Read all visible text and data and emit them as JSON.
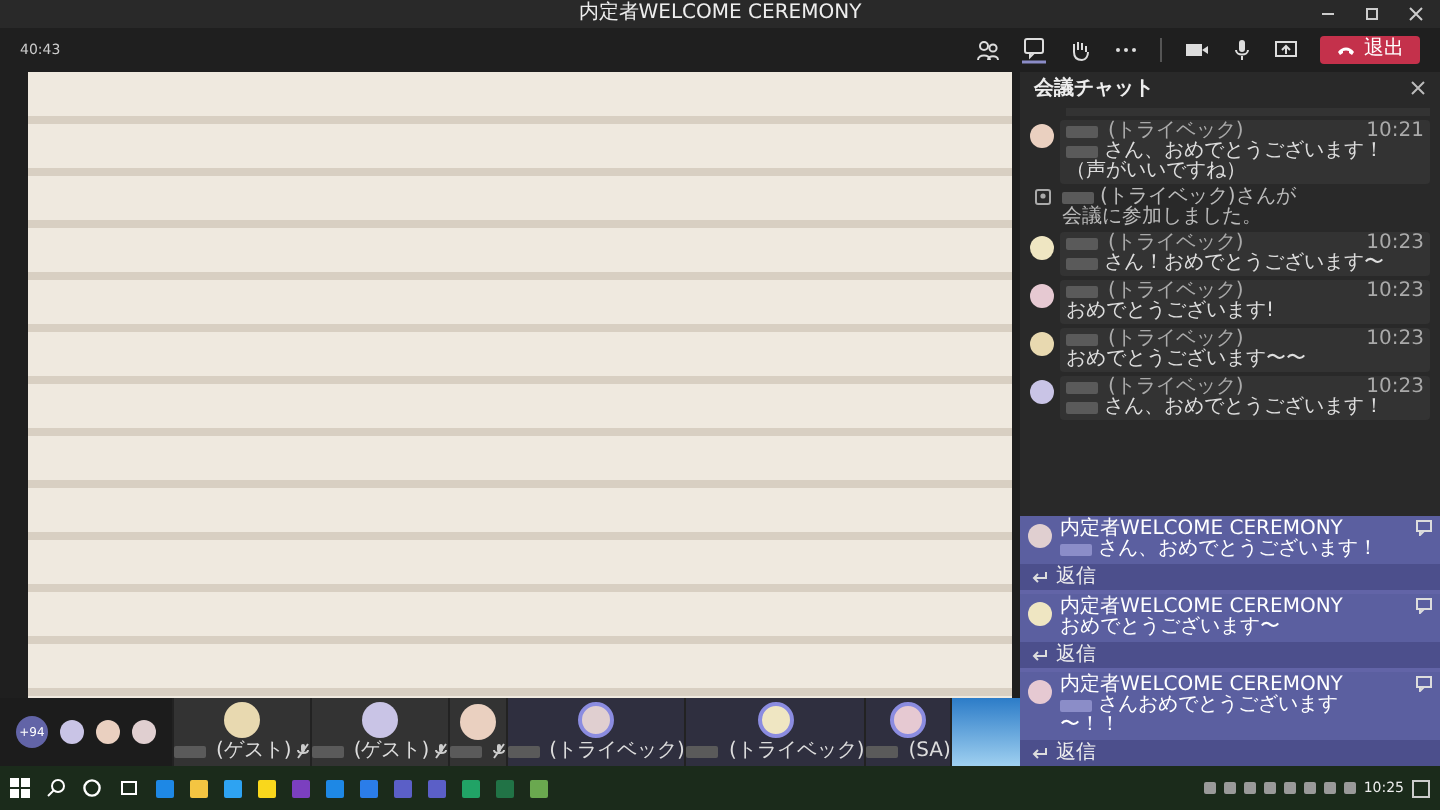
{
  "window": {
    "title": "内定者WELCOME CEREMONY"
  },
  "meeting_bar": {
    "timer": "40:43",
    "leave_label": "退出"
  },
  "chat": {
    "title": "会議チャット",
    "messages": [
      {
        "kind": "message",
        "org": "(トライベック)",
        "time": "10:21",
        "lines": [
          {
            "mention": true,
            "text": "さん、おめでとうございます！"
          },
          {
            "mention": false,
            "text": "（声がいいですね）"
          }
        ]
      },
      {
        "kind": "system",
        "org": "(トライベック)",
        "lines": [
          "さんが",
          "会議に参加しました。"
        ]
      },
      {
        "kind": "message",
        "org": "(トライベック)",
        "time": "10:23",
        "lines": [
          {
            "mention": true,
            "text": "さん！おめでとうございます〜"
          }
        ]
      },
      {
        "kind": "message",
        "org": "(トライベック)",
        "time": "10:23",
        "lines": [
          {
            "mention": false,
            "text": "おめでとうございます!"
          }
        ]
      },
      {
        "kind": "message",
        "org": "(トライベック)",
        "time": "10:23",
        "lines": [
          {
            "mention": false,
            "text": "おめでとうございます〜〜"
          }
        ]
      },
      {
        "kind": "message",
        "org": "(トライベック)",
        "time": "10:23",
        "lines": [
          {
            "mention": true,
            "text": "さん、おめでとうございます！"
          }
        ]
      }
    ],
    "notifications": [
      {
        "sender": "内定者WELCOME CEREMONY",
        "lines": [
          {
            "mention": true,
            "text": "さん、おめでとうございます！"
          }
        ],
        "reply_label": "返信"
      },
      {
        "sender": "内定者WELCOME CEREMONY",
        "lines": [
          {
            "mention": false,
            "text": "おめでとうございます〜"
          }
        ],
        "reply_label": "返信"
      },
      {
        "sender": "内定者WELCOME CEREMONY",
        "lines": [
          {
            "mention": true,
            "text": "さんおめでとうございます"
          },
          {
            "mention": false,
            "text": "〜！！"
          }
        ],
        "reply_label": "返信"
      }
    ]
  },
  "participants": {
    "overflow": "+94",
    "tiles": [
      {
        "label": "(ゲスト)",
        "speaking": false,
        "muted": true
      },
      {
        "label": "(ゲスト)",
        "speaking": false,
        "muted": true
      },
      {
        "speaking": false,
        "muted": true
      },
      {
        "label": "(トライベック)",
        "speaking": true,
        "muted": false
      },
      {
        "label": "(トライベック)",
        "speaking": true,
        "muted": false
      },
      {
        "label": "(SA)",
        "speaking": true,
        "muted": false
      }
    ]
  },
  "taskbar": {
    "time": "10:25"
  }
}
